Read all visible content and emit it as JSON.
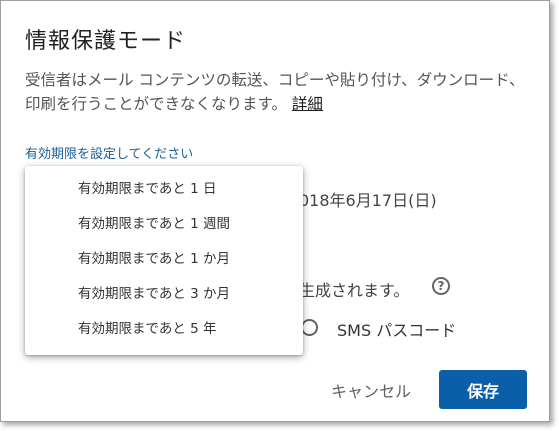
{
  "dialog": {
    "title": "情報保護モード",
    "description": "受信者はメール コンテンツの転送、コピーや貼り付け、ダウンロード、印刷を行うことができなくなります。",
    "detail_link": "詳細",
    "expiration_label": "有効期限を設定してください",
    "expiration_date_partial": "018年6月17日(日)",
    "passcode_text_partial": "生成されます。",
    "sms_option": "SMS パスコード",
    "cancel_button": "キャンセル",
    "save_button": "保存"
  },
  "expiration_menu": {
    "items": [
      {
        "label": "有効期限まであと 1 日"
      },
      {
        "label": "有効期限まであと 1 週間"
      },
      {
        "label": "有効期限まであと 1 か月"
      },
      {
        "label": "有効期限まであと 3 か月"
      },
      {
        "label": "有効期限まであと 5 年"
      }
    ]
  },
  "colors": {
    "accent": "#0b5fa8",
    "link": "#1a5f97"
  },
  "icons": {
    "help": "help-icon",
    "radio": "radio-unchecked-icon"
  }
}
